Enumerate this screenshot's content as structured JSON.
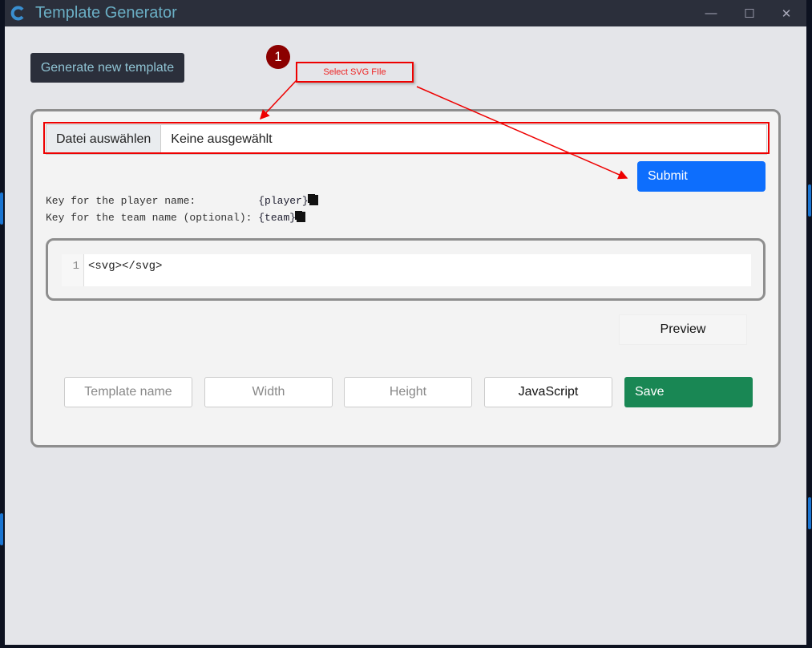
{
  "window": {
    "title": "Template Generator",
    "minimize_icon": "minimize-icon",
    "maximize_icon": "maximize-icon",
    "close_icon": "close-icon"
  },
  "toolbar": {
    "generate_label": "Generate new template"
  },
  "file_input": {
    "button_label": "Datei auswählen",
    "value": "Keine ausgewählt"
  },
  "submit_label": "Submit",
  "keys": [
    {
      "label": "Key for the player name:          ",
      "value": "{player}"
    },
    {
      "label": "Key for the team name (optional): ",
      "value": "{team}"
    }
  ],
  "editor": {
    "line_number": "1",
    "content": "<svg></svg>"
  },
  "preview_label": "Preview",
  "fields": {
    "template_name": "Template name",
    "width": "Width",
    "height": "Height",
    "javascript": "JavaScript"
  },
  "save_label": "Save",
  "annotation": {
    "step": "1",
    "text": "Select SVG FIle",
    "color": "#ee0000"
  },
  "colors": {
    "submit": "#0d6efd",
    "save": "#198754",
    "titlebar": "#2b2f3b"
  }
}
